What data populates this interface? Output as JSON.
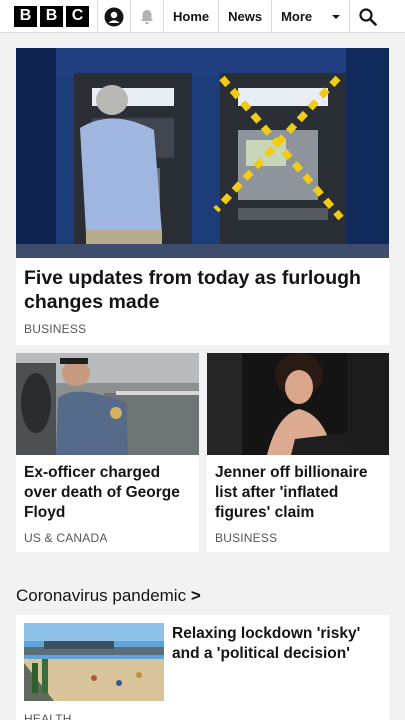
{
  "brand": {
    "letters": [
      "B",
      "B",
      "C"
    ]
  },
  "nav": {
    "home": "Home",
    "news": "News",
    "more": "More"
  },
  "icons": {
    "account": "account-icon",
    "bell": "bell-icon",
    "search": "search-icon",
    "chevron": "chevron-down-icon"
  },
  "stories": [
    {
      "headline": "Five updates from today as furlough changes made",
      "tag": "BUSINESS"
    },
    {
      "headline": "Ex-officer charged over death of George Floyd",
      "tag": "US & CANADA"
    },
    {
      "headline": "Jenner off billionaire list after 'inflated figures' claim",
      "tag": "BUSINESS"
    }
  ],
  "section": {
    "title": "Coronavirus pandemic",
    "arrow": ">"
  },
  "section_story": {
    "headline": "Relaxing lockdown 'risky' and a 'political decision'",
    "tag": "HEALTH"
  }
}
